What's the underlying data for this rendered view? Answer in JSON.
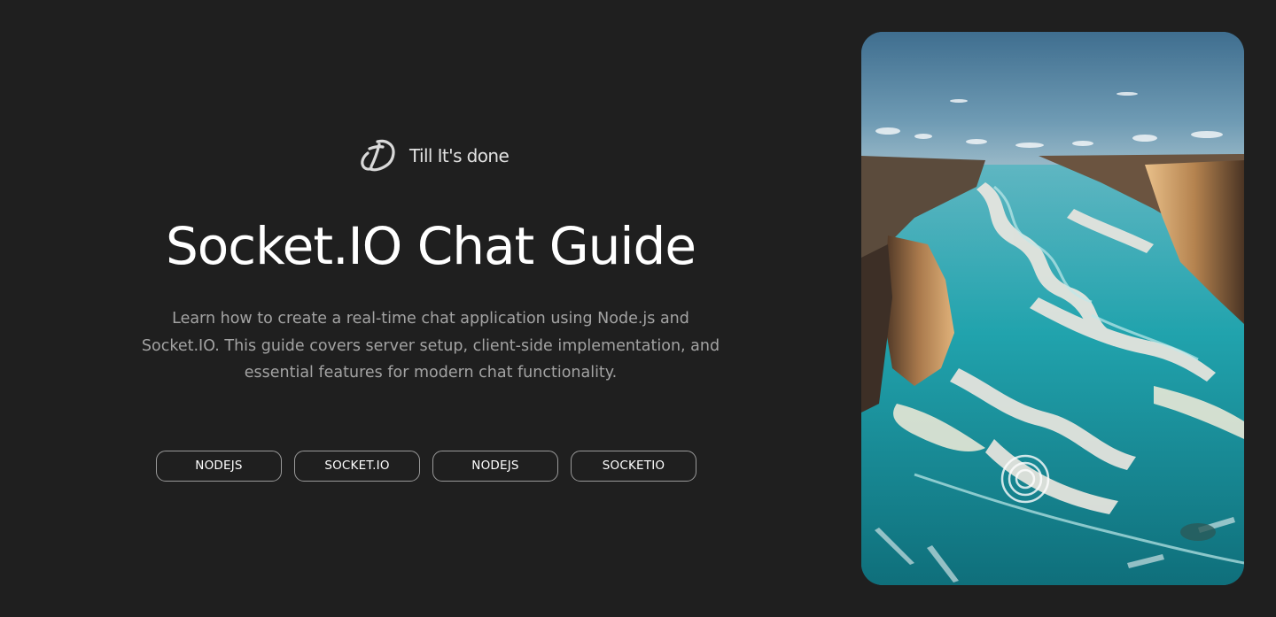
{
  "brand": {
    "name": "Till It's done",
    "logo_icon": "td-monogram-logo-icon"
  },
  "hero": {
    "title": "Socket.IO Chat Guide",
    "description": "Learn how to create a real-time chat application using Node.js and Socket.IO. This guide covers server setup, client-side implementation, and essential features for modern chat functionality."
  },
  "tags": [
    {
      "label": "NODEJS"
    },
    {
      "label": "SOCKET.IO"
    },
    {
      "label": "NODEJS"
    },
    {
      "label": "SOCKETIO"
    }
  ],
  "image": {
    "icon": "aerial-river-canyon-image"
  },
  "colors": {
    "background": "#1f1f1f",
    "text_primary": "#ffffff",
    "text_secondary": "#a3a3a3",
    "tag_border": "#9a9a9a"
  }
}
